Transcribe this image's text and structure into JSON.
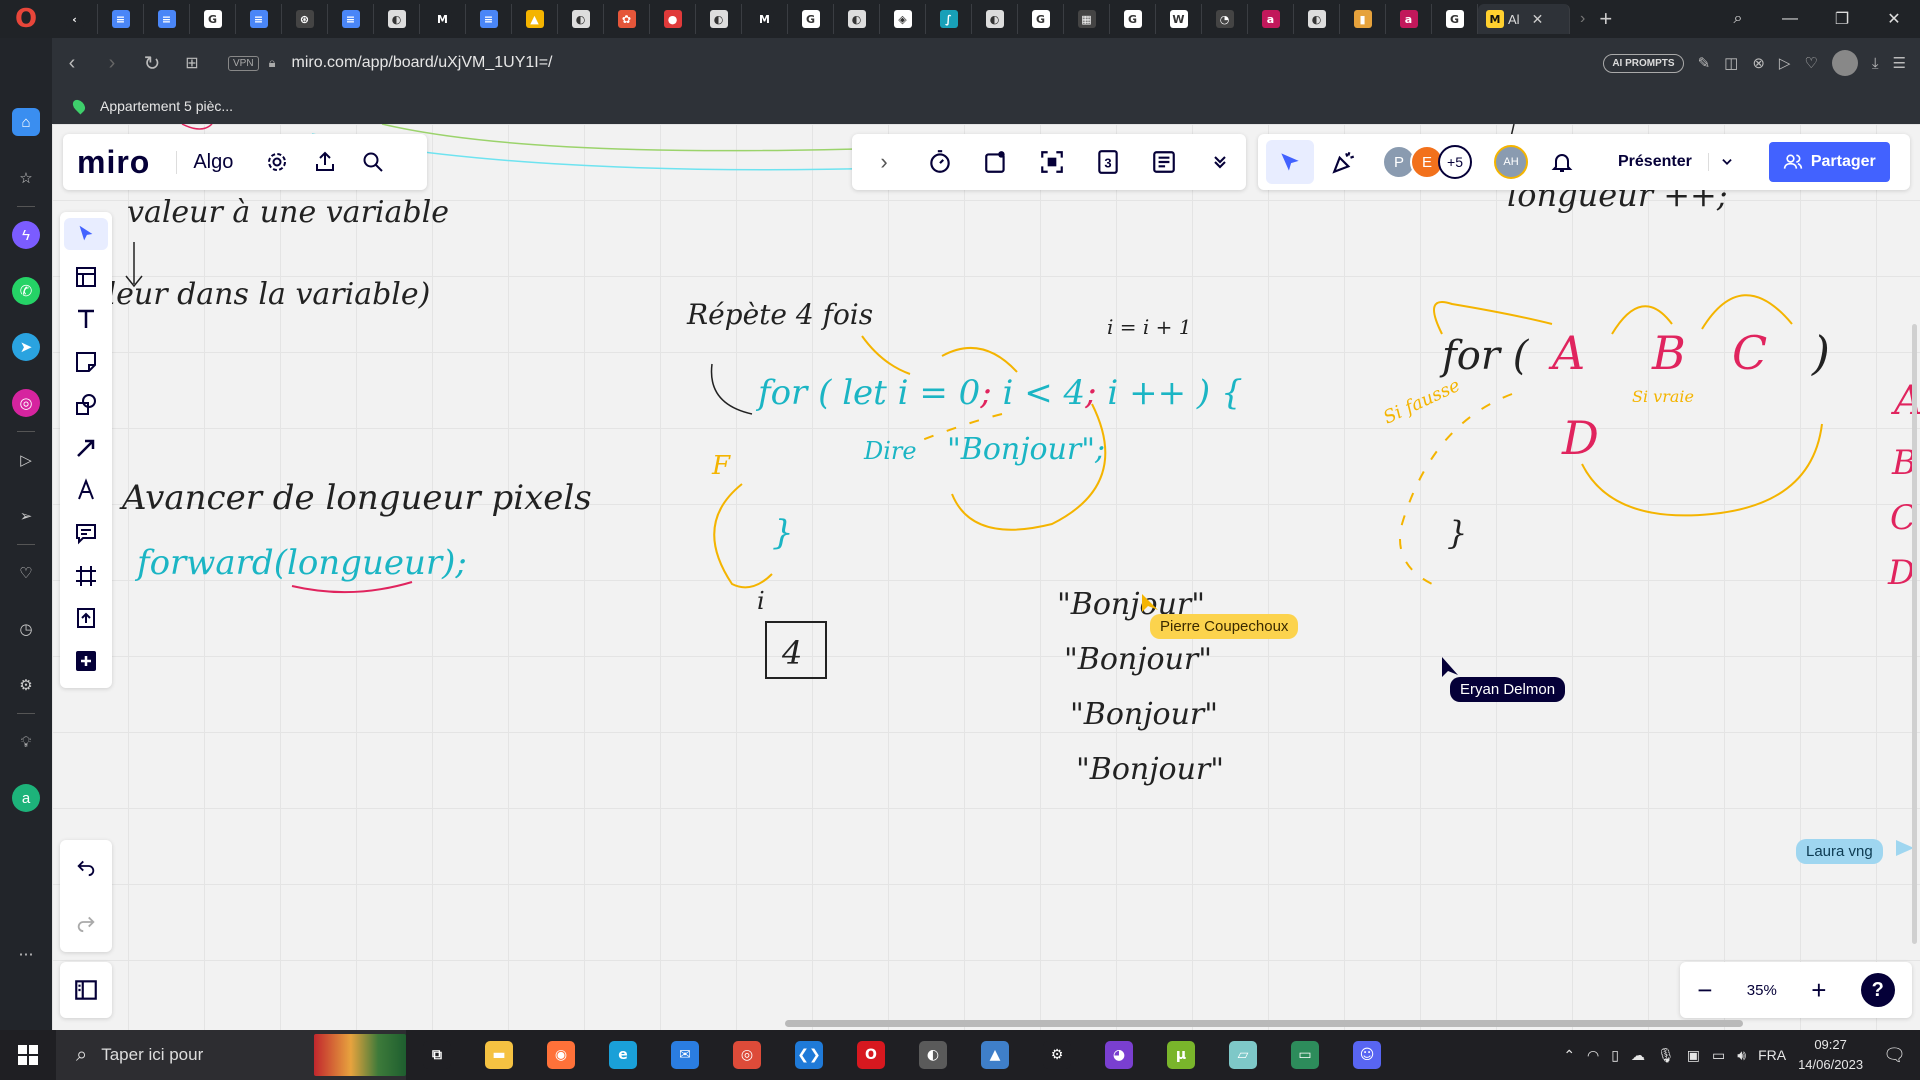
{
  "browser": {
    "url": "miro.com/app/board/uXjVM_1UY1I=/",
    "vpn_label": "VPN",
    "active_tab_title": "Al",
    "ai_prompts_label": "AI PROMPTS",
    "bookmark_label": "Appartement 5 pièc...",
    "tab_favicons": [
      {
        "icon": "chevron-left-icon",
        "color": "#202327",
        "glyph": "‹"
      },
      {
        "icon": "docs-icon",
        "color": "#4a86f7",
        "glyph": "≡"
      },
      {
        "icon": "docs-icon",
        "color": "#4a86f7",
        "glyph": "≡"
      },
      {
        "icon": "google-icon",
        "color": "#ffffff",
        "glyph": "G"
      },
      {
        "icon": "docs-icon",
        "color": "#4a86f7",
        "glyph": "≡"
      },
      {
        "icon": "sphere-icon",
        "color": "#444444",
        "glyph": "⊛"
      },
      {
        "icon": "docs-icon",
        "color": "#4a86f7",
        "glyph": "≡"
      },
      {
        "icon": "opera-tab-icon",
        "color": "#dddddd",
        "glyph": "◐"
      },
      {
        "icon": "m-icon",
        "color": "#202327",
        "glyph": "M"
      },
      {
        "icon": "docs-icon",
        "color": "#4a86f7",
        "glyph": "≡"
      },
      {
        "icon": "drive-icon",
        "color": "#f4b400",
        "glyph": "▲"
      },
      {
        "icon": "opera-tab-icon",
        "color": "#dddddd",
        "glyph": "◐"
      },
      {
        "icon": "photos-icon",
        "color": "#e5563a",
        "glyph": "✿"
      },
      {
        "icon": "record-icon",
        "color": "#e03a3a",
        "glyph": "●"
      },
      {
        "icon": "opera-tab-icon",
        "color": "#dddddd",
        "glyph": "◐"
      },
      {
        "icon": "m-icon",
        "color": "#202327",
        "glyph": "M"
      },
      {
        "icon": "google-icon",
        "color": "#ffffff",
        "glyph": "G"
      },
      {
        "icon": "opera-tab-icon",
        "color": "#dddddd",
        "glyph": "◐"
      },
      {
        "icon": "codepen-icon",
        "color": "#ffffff",
        "glyph": "◈"
      },
      {
        "icon": "curve-icon",
        "color": "#18a0b8",
        "glyph": "∫"
      },
      {
        "icon": "opera-tab-icon",
        "color": "#dddddd",
        "glyph": "◐"
      },
      {
        "icon": "google-icon",
        "color": "#ffffff",
        "glyph": "G"
      },
      {
        "icon": "grid-icon",
        "color": "#444444",
        "glyph": "▦"
      },
      {
        "icon": "google-icon",
        "color": "#ffffff",
        "glyph": "G"
      },
      {
        "icon": "wikipedia-icon",
        "color": "#ffffff",
        "glyph": "W"
      },
      {
        "icon": "clock-icon",
        "color": "#444444",
        "glyph": "◔"
      },
      {
        "icon": "a-icon",
        "color": "#c2185b",
        "glyph": "a"
      },
      {
        "icon": "opera-tab-icon",
        "color": "#dddddd",
        "glyph": "◐"
      },
      {
        "icon": "bars-icon",
        "color": "#e6a23c",
        "glyph": "▮"
      },
      {
        "icon": "a-icon",
        "color": "#c2185b",
        "glyph": "a"
      },
      {
        "icon": "google-icon",
        "color": "#ffffff",
        "glyph": "G"
      }
    ]
  },
  "miro": {
    "logo": "miro",
    "board_name": "Algo",
    "present_label": "Présenter",
    "share_label": "Partager",
    "avatars": [
      {
        "initial": "P",
        "color": "#8a9bb0"
      },
      {
        "initial": "E",
        "color": "#f2711c"
      }
    ],
    "more_count": "+5",
    "self_avatar": "AH",
    "zoom": "35%",
    "frame_count": "3",
    "accent_color": "#4262ff"
  },
  "board_text": {
    "line1": "valeur à une variable",
    "line2": "(valeur dans la variable)",
    "line3": "Avancer de longueur pixels",
    "forward": "forward(longueur);",
    "repeat": "Répète 4 fois",
    "for_loop_parts": [
      "for ( ",
      "let i = 0",
      "; ",
      "i < 4",
      "; ",
      "i ++",
      " ) {"
    ],
    "dire": "Dire",
    "bonjour": "\"Bonjour\";",
    "i_eq": "i = i + 1",
    "f_label": "F",
    "brace_close": "}",
    "i_label": "i",
    "counter": "4",
    "bonjours": [
      "\"Bonjour\"",
      "\"Bonjour\"",
      "\"Bonjour\"",
      "\"Bonjour\""
    ],
    "longueur_pp": "longueur ++;",
    "generic_for": "for (",
    "generic_a": "A",
    "generic_b": "B",
    "generic_c": "C",
    "generic_close": ")",
    "generic_d": "D",
    "si_fausse": "Si fausse",
    "si_vraie": "Si vraie",
    "right_col": [
      "A",
      "B",
      "C",
      "D"
    ],
    "cursors": [
      {
        "name": "Pierre Coupechoux",
        "color": "#fcd34d",
        "text_color": "#3a2a00"
      },
      {
        "name": "Eryan Delmon",
        "color": "#050038",
        "text_color": "#ffffff"
      },
      {
        "name": "Laura vng",
        "color": "#9fd6f0",
        "text_color": "#0d3b52"
      }
    ]
  },
  "taskbar": {
    "search_placeholder": "Taper ici pour",
    "language": "FRA",
    "time": "09:27",
    "date": "14/06/2023",
    "apps": [
      {
        "icon": "task-view-icon",
        "color": "#1f1f23",
        "glyph": "⧉"
      },
      {
        "icon": "file-explorer-icon",
        "color": "#f5c242",
        "glyph": "▬"
      },
      {
        "icon": "firefox-icon",
        "color": "#ff7139",
        "glyph": "◉"
      },
      {
        "icon": "edge-icon",
        "color": "#1aa0d8",
        "glyph": "e"
      },
      {
        "icon": "mail-icon",
        "color": "#2a7de1",
        "glyph": "✉"
      },
      {
        "icon": "chrome-icon",
        "color": "#dd4b39",
        "glyph": "◎"
      },
      {
        "icon": "vscode-icon",
        "color": "#1f7ad8",
        "glyph": "❮❯"
      },
      {
        "icon": "opera-icon",
        "color": "#d7181f",
        "glyph": "O"
      },
      {
        "icon": "eclipse-icon",
        "color": "#5a5a5a",
        "glyph": "◐"
      },
      {
        "icon": "photos-icon",
        "color": "#3f7fc9",
        "glyph": "▲"
      },
      {
        "icon": "settings-icon",
        "color": "#1f1f23",
        "glyph": "⚙"
      },
      {
        "icon": "mask-icon",
        "color": "#7a3fd0",
        "glyph": "◕"
      },
      {
        "icon": "utorrent-icon",
        "color": "#79b52b",
        "glyph": "µ"
      },
      {
        "icon": "notepad-icon",
        "color": "#7ec8c8",
        "glyph": "▱"
      },
      {
        "icon": "presentation-icon",
        "color": "#2d8c5b",
        "glyph": "▭"
      },
      {
        "icon": "discord-icon",
        "color": "#5865f2",
        "glyph": "☺"
      }
    ]
  }
}
